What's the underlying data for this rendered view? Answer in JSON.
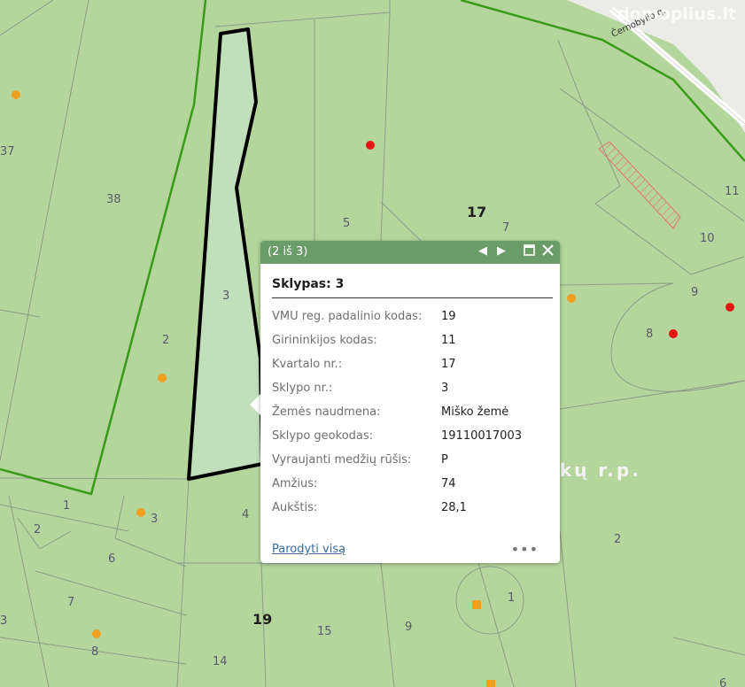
{
  "watermark": "domoplius.lt",
  "map": {
    "street_name": "Černobylio g.",
    "district_label": "...kų r.p.",
    "quarter_labels": [
      "17",
      "19"
    ],
    "parcel_labels": [
      "37",
      "38",
      "2",
      "3",
      "5",
      "7",
      "11",
      "10",
      "9",
      "8",
      "1",
      "2",
      "3",
      "4",
      "6",
      "7",
      "8",
      "15",
      "9",
      "1",
      "14",
      "2",
      "3",
      "6"
    ],
    "colors": {
      "forest": "#b4d69c",
      "parcel_line": "#8e9b8a",
      "district_border": "#3a9a1a",
      "selected_outline": "#000000",
      "selected_fill": "#cfeae0",
      "orange_point": "#f0a020",
      "red_point": "#e21414",
      "hatch": "#e67070"
    }
  },
  "popup": {
    "pager": "(2 iš 3)",
    "prev_icon": "triangle-left",
    "next_icon": "triangle-right",
    "maximize_icon": "square",
    "close_icon": "x",
    "title": "Sklypas: 3",
    "fields": [
      {
        "label": "VMU reg. padalinio kodas:",
        "value": "19"
      },
      {
        "label": "Girininkijos kodas:",
        "value": "11"
      },
      {
        "label": "Kvartalo nr.:",
        "value": "17"
      },
      {
        "label": "Sklypo nr.:",
        "value": "3"
      },
      {
        "label": "Žemės naudmena:",
        "value": "Miško žemė"
      },
      {
        "label": "Sklypo geokodas:",
        "value": "19110017003"
      },
      {
        "label": "Vyraujanti medžių rūšis:",
        "value": "P"
      },
      {
        "label": "Amžius:",
        "value": "74"
      },
      {
        "label": "Aukštis:",
        "value": "28,1"
      }
    ],
    "show_all": "Parodyti visą",
    "more": "•••"
  }
}
